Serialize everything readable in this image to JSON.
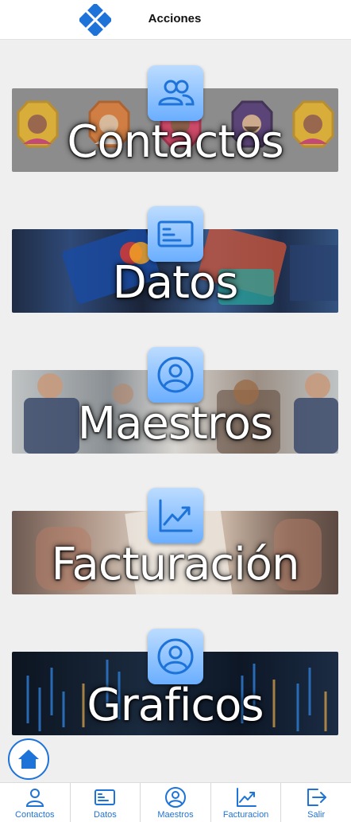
{
  "header": {
    "title": "Acciones"
  },
  "colors": {
    "accent": "#1e73d9",
    "tile_light": "#bcdcff",
    "tile_dark": "#6aaeff"
  },
  "cards": [
    {
      "label": "Contactos",
      "icon": "users-icon"
    },
    {
      "label": "Datos",
      "icon": "credit-card-icon"
    },
    {
      "label": "Maestros",
      "icon": "user-circle-icon"
    },
    {
      "label": "Facturación",
      "icon": "chart-line-icon"
    },
    {
      "label": "Graficos",
      "icon": "user-circle-icon"
    }
  ],
  "fab": {
    "icon": "home-icon"
  },
  "bottom_nav": [
    {
      "label": "Contactos",
      "icon": "user-icon"
    },
    {
      "label": "Datos",
      "icon": "credit-card-icon"
    },
    {
      "label": "Maestros",
      "icon": "user-circle-icon"
    },
    {
      "label": "Facturacion",
      "icon": "chart-line-icon"
    },
    {
      "label": "Salir",
      "icon": "logout-icon"
    }
  ]
}
